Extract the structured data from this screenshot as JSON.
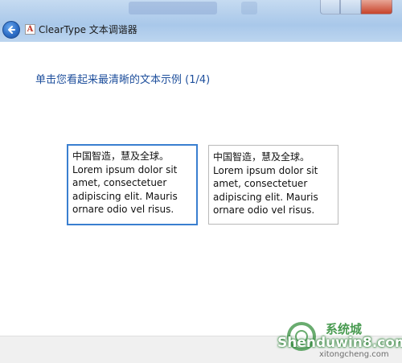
{
  "window": {
    "title": "ClearType 文本调谐器",
    "app_icon_glyph": "A",
    "icons": {
      "back": "back-arrow-icon",
      "app": "cleartype-app-icon"
    },
    "accent_color": "#3a7fd0"
  },
  "main": {
    "heading": "单击您看起来最清晰的文本示例 (1/4)",
    "samples": [
      {
        "line1": "中国智造，慧及全球。",
        "line2": "Lorem ipsum dolor sit amet, consectetuer adipiscing elit. Mauris ornare odio vel risus.",
        "selected": true
      },
      {
        "line1": "中国智造，慧及全球。",
        "line2": "Lorem ipsum dolor sit amet, consectetuer adipiscing elit. Mauris ornare odio vel risus.",
        "selected": false
      }
    ]
  },
  "watermark": {
    "text": "Shenduwin8.com",
    "sub": "xitongcheng.com",
    "cn": "系统城"
  }
}
